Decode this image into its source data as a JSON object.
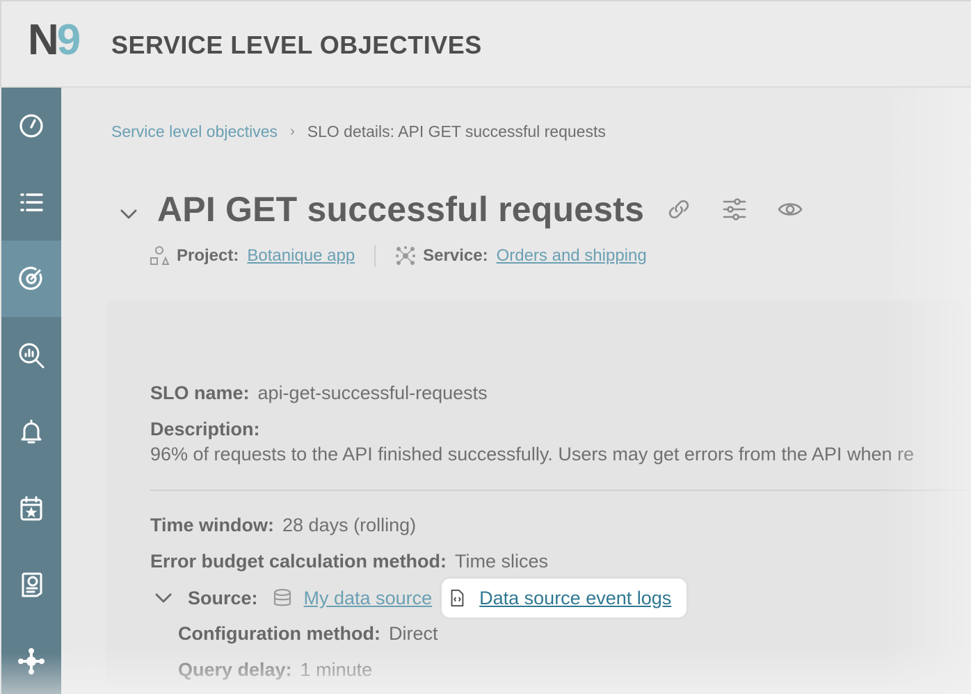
{
  "header": {
    "logo_main": "N",
    "logo_accent": "9",
    "title": "SERVICE LEVEL OBJECTIVES"
  },
  "sidebar": {
    "items": [
      {
        "icon": "speedometer-icon"
      },
      {
        "icon": "list-icon"
      },
      {
        "icon": "target-icon",
        "active": true
      },
      {
        "icon": "analytics-search-icon"
      },
      {
        "icon": "bell-icon"
      },
      {
        "icon": "calendar-star-icon"
      },
      {
        "icon": "report-icon"
      },
      {
        "icon": "integrations-icon"
      }
    ]
  },
  "breadcrumb": {
    "parent": "Service level objectives",
    "separator": "›",
    "current": "SLO details: API GET successful requests"
  },
  "slo": {
    "title": "API GET successful requests",
    "project_label": "Project:",
    "project_value": "Botanique app",
    "service_label": "Service:",
    "service_value": "Orders and shipping"
  },
  "details": {
    "slo_name_label": "SLO name:",
    "slo_name_value": "api-get-successful-requests",
    "description_label": "Description:",
    "description_value": "96% of requests to the API finished successfully. Users may get errors from the API when re",
    "time_window_label": "Time window:",
    "time_window_value": "28 days (rolling)",
    "error_budget_label": "Error budget calculation method:",
    "error_budget_value": "Time slices",
    "source_label": "Source:",
    "source_value": "My data source",
    "event_logs_link": "Data source event logs",
    "config_method_label": "Configuration method:",
    "config_method_value": "Direct",
    "query_delay_label": "Query delay:",
    "query_delay_value": "1 minute"
  },
  "colors": {
    "sidebar": "#607f8c",
    "sidebar_active": "#6d93a2",
    "link": "#6a9fb3",
    "highlight_link": "#2f7892"
  }
}
